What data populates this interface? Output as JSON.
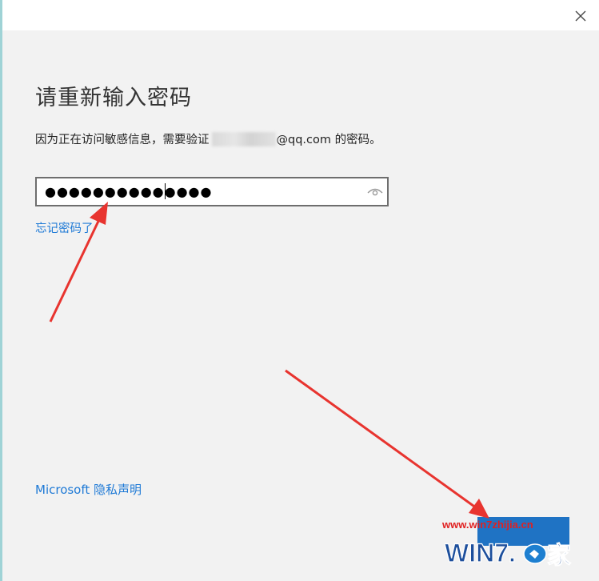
{
  "dialog": {
    "title": "请重新输入密码",
    "description_prefix": "因为正在访问敏感信息，需要验证",
    "description_email_suffix": "@qq.com 的密码。",
    "password_value": "●●●●●●●●●●●●●●",
    "forgot_password_label": "忘记密码了",
    "privacy_link_label": "Microsoft 隐私声明"
  },
  "icons": {
    "close": "close-icon",
    "reveal_password": "eye-icon"
  },
  "watermark": {
    "url": "www.win7zhijia.cn",
    "logo_text": "WIN7之家"
  },
  "colors": {
    "link": "#1f7ad6",
    "button": "#1f73c4",
    "arrow": "#e8342f",
    "background": "#f2f2f2"
  }
}
